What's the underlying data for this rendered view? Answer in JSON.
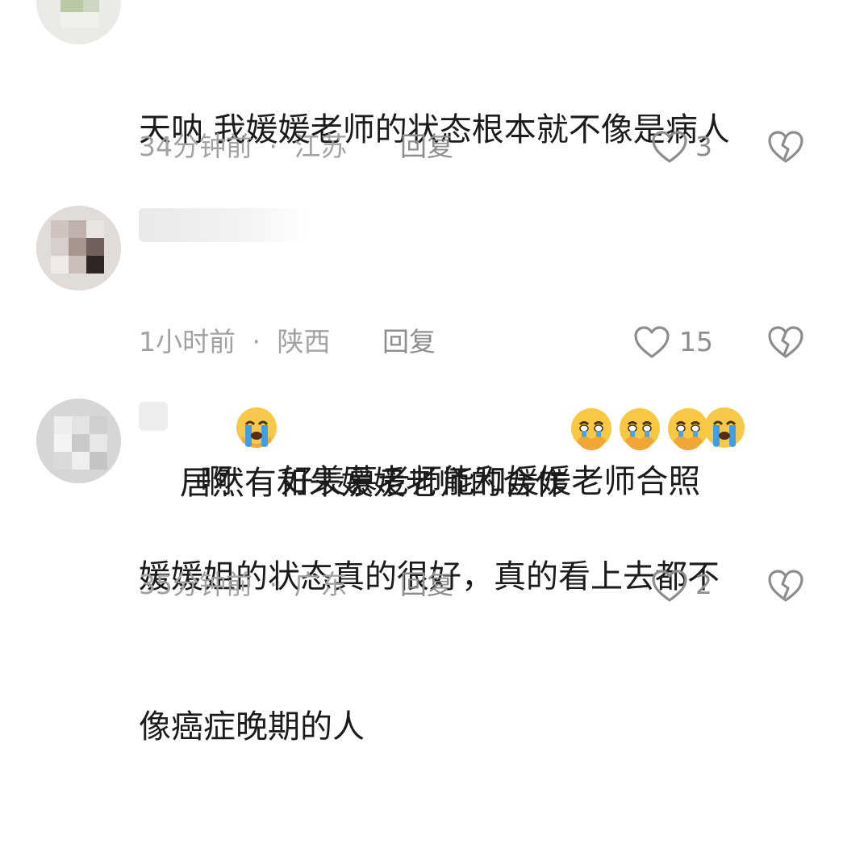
{
  "comments": [
    {
      "text": "天呐 我媛媛老师的状态根本就不像是病人啊",
      "text_line1": "天呐 我媛媛老师的状态根本就不像是病人",
      "text_line2_a": "啊",
      "text_line2_b": "好羡慕老师能和媛媛老师合照",
      "emojis": [
        "crying-face",
        "crying-face"
      ],
      "time": "34分钟前",
      "separator": "·",
      "location": "江苏",
      "reply_label": "回复",
      "likes": "3"
    },
    {
      "text": "居然有和朱媛媛老师的合作",
      "emojis": [
        "holding-back-tears",
        "holding-back-tears",
        "holding-back-tears"
      ],
      "time": "1小时前",
      "separator": "·",
      "location": "陕西",
      "reply_label": "回复",
      "likes": "15"
    },
    {
      "text_line1": "媛媛姐的状态真的很好，真的看上去都不",
      "text_line2": "像癌症晚期的人",
      "time": "35分钟前",
      "separator": "·",
      "location": "广东",
      "reply_label": "回复",
      "likes": "2"
    }
  ],
  "colors": {
    "text": "#1b1b1b",
    "meta": "#a2a2a2",
    "icon": "#8d8d8d"
  },
  "icons": {
    "like": "heart-outline-icon",
    "dislike": "broken-heart-icon"
  }
}
